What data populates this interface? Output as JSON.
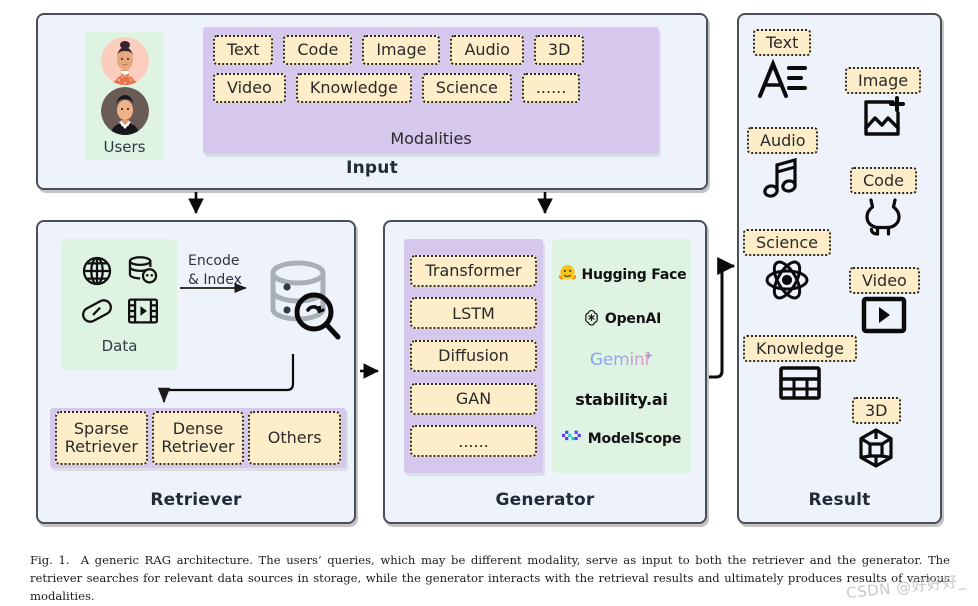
{
  "figure": {
    "caption_number": "Fig. 1.",
    "caption_text": "A generic RAG architecture. The users’ queries, which may be different modality, serve as input to both the retriever and the generator. The retriever searches for relevant data sources in storage, while the generator interacts with the retrieval results and ultimately produces results of various modalities.",
    "watermark": "CSDN @好好好_"
  },
  "colors": {
    "panel_bg": "#eef2fb",
    "panel_border": "#4b4f57",
    "purple_group": "#d6c8ec",
    "green_group": "#dff3e2",
    "tag_fill": "#fdeec9",
    "tag_border": "#2c2c2c",
    "storage_gray": "#a9b0b5"
  },
  "input": {
    "title": "Input",
    "users": {
      "label": "Users",
      "avatars": [
        "user-avatar-female",
        "user-avatar-male"
      ]
    },
    "modalities": {
      "label": "Modalities",
      "row1": [
        "Text",
        "Code",
        "Image",
        "Audio",
        "3D"
      ],
      "row2": [
        "Video",
        "Knowledge",
        "Science",
        "......"
      ]
    }
  },
  "retriever": {
    "title": "Retriever",
    "data": {
      "label": "Data",
      "icons": [
        "globe-icon",
        "database-icon",
        "capsule-icon",
        "film-icon"
      ]
    },
    "encode_label": "Encode\n& Index",
    "storage_icon": "database-search-icon",
    "retrievers": [
      "Sparse Retriever",
      "Dense Retriever",
      "Others"
    ]
  },
  "generator": {
    "title": "Generator",
    "models": [
      "Transformer",
      "LSTM",
      "Diffusion",
      "GAN",
      "......"
    ],
    "providers": [
      {
        "name": "Hugging Face",
        "icon": "hugging-face-icon"
      },
      {
        "name": "OpenAI",
        "icon": "openai-icon"
      },
      {
        "name": "Gemini",
        "icon": "gemini-icon"
      },
      {
        "name": "stability.ai",
        "icon": "stability-ai-icon"
      },
      {
        "name": "ModelScope",
        "icon": "modelscope-icon"
      }
    ]
  },
  "result": {
    "title": "Result",
    "items": [
      {
        "label": "Text",
        "icon": "text-format-icon",
        "side": "left"
      },
      {
        "label": "Image",
        "icon": "image-add-icon",
        "side": "right"
      },
      {
        "label": "Audio",
        "icon": "music-note-icon",
        "side": "left"
      },
      {
        "label": "Code",
        "icon": "github-icon",
        "side": "right"
      },
      {
        "label": "Science",
        "icon": "atom-icon",
        "side": "left"
      },
      {
        "label": "Video",
        "icon": "video-play-icon",
        "side": "right"
      },
      {
        "label": "Knowledge",
        "icon": "table-grid-icon",
        "side": "left"
      },
      {
        "label": "3D",
        "icon": "cube-3d-icon",
        "side": "right"
      }
    ]
  },
  "connectors": {
    "input_to_retriever": "arrow-down",
    "input_to_generator": "arrow-down",
    "retriever_to_generator": "arrow-right",
    "generator_to_result": "arrow-elbow-right",
    "data_to_storage": "arrow-right",
    "storage_to_retrievers": "arrow-elbow-down"
  }
}
